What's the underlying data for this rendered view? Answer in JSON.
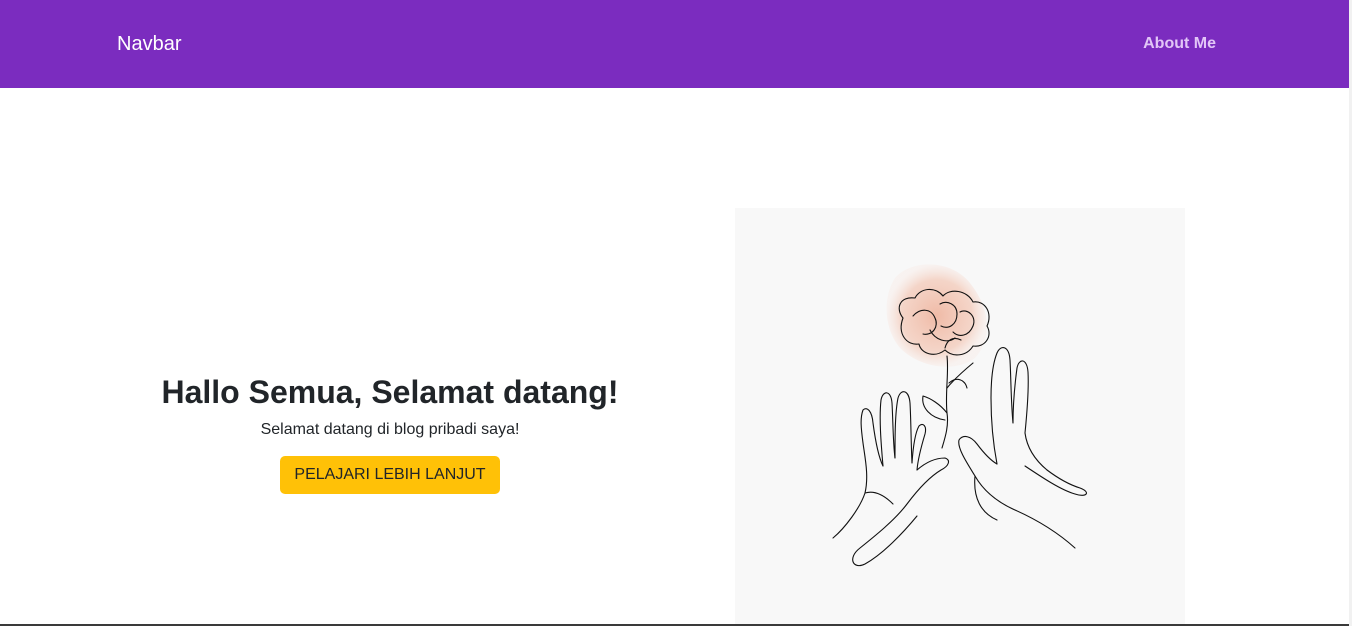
{
  "navbar": {
    "brand": "Navbar",
    "links": [
      {
        "label": "About Me"
      }
    ]
  },
  "hero": {
    "title": "Hallo Semua, Selamat datang!",
    "subtitle": "Selamat datang di blog pribadi saya!",
    "button_label": "PELAJARI LEBIH LANJUT"
  },
  "colors": {
    "navbar_bg": "#7b2cbf",
    "nav_link": "#e2c6f7",
    "button_bg": "#ffc107",
    "illustration_bg": "#f8f8f8",
    "flower_wash": "#f2c1ad"
  },
  "illustration": {
    "description_icon": "flower-hands-line-art"
  }
}
